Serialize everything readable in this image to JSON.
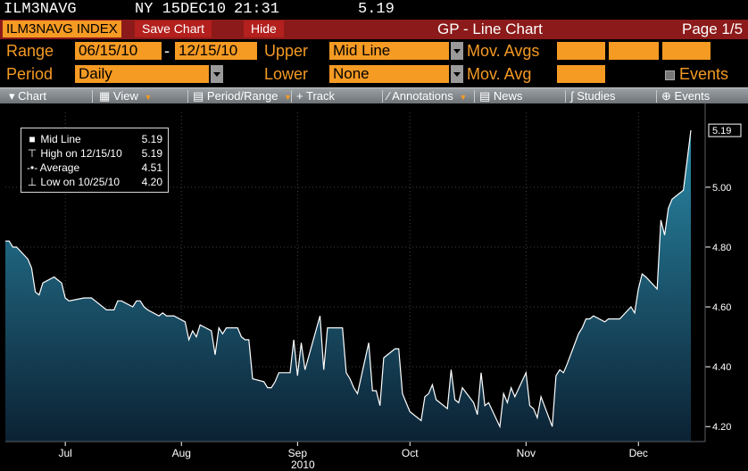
{
  "ticker": {
    "symbol": "ILM3NAVG",
    "exchange_date": "NY 15DEC10",
    "time": "21:31",
    "last": "5.19"
  },
  "title_bar": {
    "index": "ILM3NAVG INDEX",
    "save_chart": "Save Chart",
    "hide": "Hide",
    "title": "GP - Line Chart",
    "page": "Page 1/5"
  },
  "controls": {
    "range_label": "Range",
    "range_start": "06/15/10",
    "range_dash": "-",
    "range_end": "12/15/10",
    "period_label": "Period",
    "period_value": "Daily",
    "upper_label": "Upper",
    "upper_value": "Mid Line",
    "lower_label": "Lower",
    "lower_value": "None",
    "mov_avgs_label": "Mov. Avgs",
    "mov_avg_label": "Mov. Avg",
    "events_label": "Events"
  },
  "toolbar": [
    "Chart",
    "View",
    "Period/Range",
    "Track",
    "Annotations",
    "News",
    "Studies",
    "Events"
  ],
  "legend": [
    {
      "symbol": "square-icon",
      "label": "Mid Line",
      "value": "5.19"
    },
    {
      "symbol": "high-marker-icon",
      "label": "High on 12/15/10",
      "value": "5.19"
    },
    {
      "symbol": "average-marker-icon",
      "label": "Average",
      "value": "4.51"
    },
    {
      "symbol": "low-marker-icon",
      "label": "Low on 10/25/10",
      "value": "4.20"
    }
  ],
  "colors": {
    "accent": "#f59a23",
    "title_bar": "#8c1a1a",
    "area_top": "#2a8aa8",
    "area_bottom": "#0c2133",
    "line": "#ffffff"
  },
  "chart_data": {
    "type": "area",
    "ylim": [
      4.15,
      5.25
    ],
    "yticks": [
      4.2,
      4.4,
      4.6,
      4.8,
      5.0
    ],
    "ytick_labels": [
      "4.20",
      "4.40",
      "4.60",
      "4.80",
      "5.00"
    ],
    "last_value_label": "5.19",
    "xticks": [
      {
        "label": "Jul",
        "date": "2010-07-01"
      },
      {
        "label": "Aug",
        "date": "2010-08-01"
      },
      {
        "label": "Sep",
        "date": "2010-09-01"
      },
      {
        "label": "Oct",
        "date": "2010-10-01"
      },
      {
        "label": "Nov",
        "date": "2010-11-01"
      },
      {
        "label": "Dec",
        "date": "2010-12-01"
      }
    ],
    "year_label": "2010",
    "series": [
      {
        "name": "Mid Line",
        "points": [
          [
            "2010-06-15",
            4.82
          ],
          [
            "2010-06-16",
            4.82
          ],
          [
            "2010-06-17",
            4.8
          ],
          [
            "2010-06-18",
            4.8
          ],
          [
            "2010-06-21",
            4.76
          ],
          [
            "2010-06-22",
            4.73
          ],
          [
            "2010-06-23",
            4.65
          ],
          [
            "2010-06-24",
            4.64
          ],
          [
            "2010-06-25",
            4.68
          ],
          [
            "2010-06-28",
            4.7
          ],
          [
            "2010-06-29",
            4.69
          ],
          [
            "2010-06-30",
            4.68
          ],
          [
            "2010-07-01",
            4.63
          ],
          [
            "2010-07-02",
            4.62
          ],
          [
            "2010-07-06",
            4.63
          ],
          [
            "2010-07-07",
            4.63
          ],
          [
            "2010-07-08",
            4.63
          ],
          [
            "2010-07-09",
            4.62
          ],
          [
            "2010-07-12",
            4.59
          ],
          [
            "2010-07-13",
            4.59
          ],
          [
            "2010-07-14",
            4.59
          ],
          [
            "2010-07-15",
            4.62
          ],
          [
            "2010-07-16",
            4.62
          ],
          [
            "2010-07-19",
            4.6
          ],
          [
            "2010-07-20",
            4.62
          ],
          [
            "2010-07-21",
            4.62
          ],
          [
            "2010-07-22",
            4.6
          ],
          [
            "2010-07-23",
            4.59
          ],
          [
            "2010-07-26",
            4.57
          ],
          [
            "2010-07-27",
            4.58
          ],
          [
            "2010-07-28",
            4.57
          ],
          [
            "2010-07-29",
            4.57
          ],
          [
            "2010-07-30",
            4.57
          ],
          [
            "2010-08-02",
            4.55
          ],
          [
            "2010-08-03",
            4.49
          ],
          [
            "2010-08-04",
            4.52
          ],
          [
            "2010-08-05",
            4.5
          ],
          [
            "2010-08-06",
            4.54
          ],
          [
            "2010-08-09",
            4.52
          ],
          [
            "2010-08-10",
            4.44
          ],
          [
            "2010-08-11",
            4.53
          ],
          [
            "2010-08-12",
            4.51
          ],
          [
            "2010-08-13",
            4.53
          ],
          [
            "2010-08-16",
            4.53
          ],
          [
            "2010-08-17",
            4.5
          ],
          [
            "2010-08-18",
            4.49
          ],
          [
            "2010-08-19",
            4.49
          ],
          [
            "2010-08-20",
            4.36
          ],
          [
            "2010-08-23",
            4.35
          ],
          [
            "2010-08-24",
            4.33
          ],
          [
            "2010-08-25",
            4.33
          ],
          [
            "2010-08-26",
            4.35
          ],
          [
            "2010-08-27",
            4.38
          ],
          [
            "2010-08-30",
            4.38
          ],
          [
            "2010-08-31",
            4.49
          ],
          [
            "2010-09-01",
            4.37
          ],
          [
            "2010-09-02",
            4.48
          ],
          [
            "2010-09-03",
            4.39
          ],
          [
            "2010-09-07",
            4.57
          ],
          [
            "2010-09-08",
            4.39
          ],
          [
            "2010-09-09",
            4.53
          ],
          [
            "2010-09-10",
            4.53
          ],
          [
            "2010-09-13",
            4.53
          ],
          [
            "2010-09-14",
            4.38
          ],
          [
            "2010-09-15",
            4.36
          ],
          [
            "2010-09-16",
            4.33
          ],
          [
            "2010-09-17",
            4.31
          ],
          [
            "2010-09-20",
            4.48
          ],
          [
            "2010-09-21",
            4.32
          ],
          [
            "2010-09-22",
            4.32
          ],
          [
            "2010-09-23",
            4.27
          ],
          [
            "2010-09-24",
            4.43
          ],
          [
            "2010-09-27",
            4.46
          ],
          [
            "2010-09-28",
            4.46
          ],
          [
            "2010-09-29",
            4.31
          ],
          [
            "2010-09-30",
            4.28
          ],
          [
            "2010-10-01",
            4.25
          ],
          [
            "2010-10-04",
            4.22
          ],
          [
            "2010-10-05",
            4.3
          ],
          [
            "2010-10-06",
            4.31
          ],
          [
            "2010-10-07",
            4.34
          ],
          [
            "2010-10-08",
            4.29
          ],
          [
            "2010-10-11",
            4.26
          ],
          [
            "2010-10-12",
            4.39
          ],
          [
            "2010-10-13",
            4.29
          ],
          [
            "2010-10-14",
            4.28
          ],
          [
            "2010-10-15",
            4.33
          ],
          [
            "2010-10-18",
            4.28
          ],
          [
            "2010-10-19",
            4.24
          ],
          [
            "2010-10-20",
            4.38
          ],
          [
            "2010-10-21",
            4.27
          ],
          [
            "2010-10-22",
            4.28
          ],
          [
            "2010-10-25",
            4.2
          ],
          [
            "2010-10-26",
            4.31
          ],
          [
            "2010-10-27",
            4.28
          ],
          [
            "2010-10-28",
            4.33
          ],
          [
            "2010-10-29",
            4.3
          ],
          [
            "2010-11-01",
            4.38
          ],
          [
            "2010-11-02",
            4.27
          ],
          [
            "2010-11-03",
            4.26
          ],
          [
            "2010-11-04",
            4.23
          ],
          [
            "2010-11-05",
            4.3
          ],
          [
            "2010-11-08",
            4.2
          ],
          [
            "2010-11-09",
            4.37
          ],
          [
            "2010-11-10",
            4.39
          ],
          [
            "2010-11-11",
            4.38
          ],
          [
            "2010-11-12",
            4.41
          ],
          [
            "2010-11-15",
            4.51
          ],
          [
            "2010-11-16",
            4.53
          ],
          [
            "2010-11-17",
            4.56
          ],
          [
            "2010-11-18",
            4.56
          ],
          [
            "2010-11-19",
            4.57
          ],
          [
            "2010-11-22",
            4.55
          ],
          [
            "2010-11-23",
            4.56
          ],
          [
            "2010-11-24",
            4.56
          ],
          [
            "2010-11-26",
            4.56
          ],
          [
            "2010-11-29",
            4.6
          ],
          [
            "2010-11-30",
            4.58
          ],
          [
            "2010-12-01",
            4.66
          ],
          [
            "2010-12-02",
            4.71
          ],
          [
            "2010-12-03",
            4.7
          ],
          [
            "2010-12-06",
            4.66
          ],
          [
            "2010-12-07",
            4.89
          ],
          [
            "2010-12-08",
            4.84
          ],
          [
            "2010-12-09",
            4.93
          ],
          [
            "2010-12-10",
            4.96
          ],
          [
            "2010-12-13",
            4.99
          ],
          [
            "2010-12-14",
            5.09
          ],
          [
            "2010-12-15",
            5.19
          ]
        ]
      }
    ]
  }
}
